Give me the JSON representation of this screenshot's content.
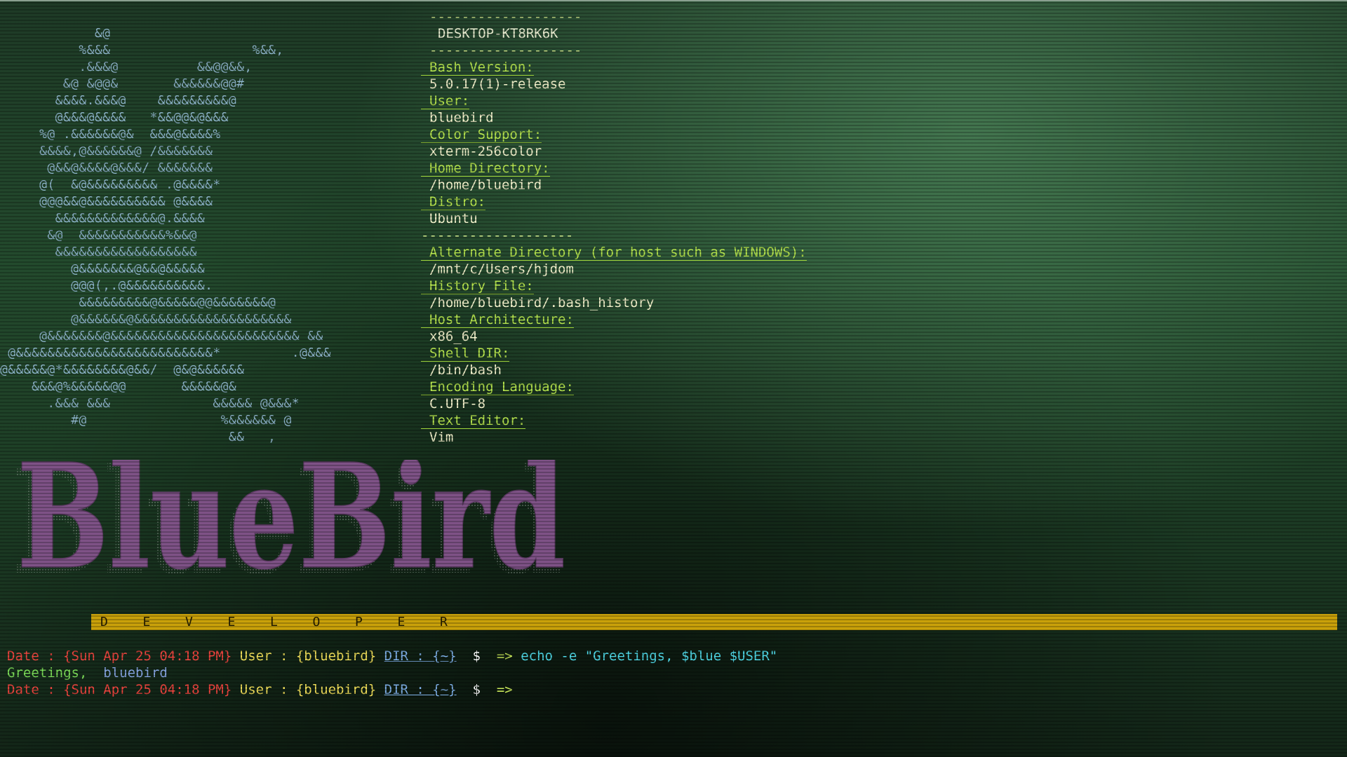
{
  "ascii_art": "            &@\n          %&&&                  %&&,\n          .&&&@          &&@@&&,\n        &@ &@@&       &&&&&&@@#\n       &&&&.&&&@    &&&&&&&&&@\n       @&&&@&&&&   *&&@@&@&&&\n     %@ .&&&&&&@&  &&&@&&&&%\n     &&&&,@&&&&&&@ /&&&&&&&\n      @&&@&&&&@&&&/ &&&&&&&\n     @(  &@&&&&&&&&& .@&&&&*\n     @@@&&@&&&&&&&&&& @&&&&\n       &&&&&&&&&&&&&@.&&&&\n      &@  &&&&&&&&&&&%&&@\n       &&&&&&&&&&&&&&&&&&\n         @&&&&&&&@&&@&&&&&\n         @@@(,.@&&&&&&&&&&.\n          &&&&&&&&&@&&&&&@@&&&&&&&@\n         @&&&&&&@&&&&&&&&&&&&&&&&&&&&\n     @&&&&&&&@&&&&&&&&&&&&&&&&&&&&&&&& &&\n @&&&&&&&&&&&&&&&&&&&&&&&&&*         .@&&&\n@&&&&&@*&&&&&&&&@&&/  @&@&&&&&&\n    &&&@%&&&&&@@       &&&&&@&\n      .&&& &&&             &&&&& @&&&*\n         #@                 %&&&&&& @\n                             &&   ,",
  "header": {
    "separator": "-------------------",
    "hostname": "DESKTOP-KT8RK6K"
  },
  "info": [
    {
      "label": "Bash Version:",
      "value": "5.0.17(1)-release"
    },
    {
      "label": "User:",
      "value": "bluebird"
    },
    {
      "label": "Color Support:",
      "value": "xterm-256color"
    },
    {
      "label": "Home Directory:",
      "value": "/home/bluebird"
    },
    {
      "label": "Distro:",
      "value": "Ubuntu"
    },
    {
      "label": "Alternate Directory (for host such as WINDOWS):",
      "value": "/mnt/c/Users/hjdom"
    },
    {
      "label": "History File:",
      "value": "/home/bluebird/.bash_history"
    },
    {
      "label": "Host Architecture:",
      "value": "x86_64"
    },
    {
      "label": "Shell DIR:",
      "value": "/bin/bash"
    },
    {
      "label": "Encoding Language:",
      "value": "C.UTF-8"
    },
    {
      "label": "Text Editor:",
      "value": "Vim"
    }
  ],
  "logo": {
    "text": "BlueBird",
    "color": "#7e5286",
    "shadow_color": "#0f1a12"
  },
  "developer_bar": {
    "letters": [
      "D",
      "E",
      "V",
      "E",
      "L",
      "O",
      "P",
      "E",
      "R"
    ],
    "color": "#c9a10a"
  },
  "prompts": [
    {
      "date": "Date : {Sun Apr 25 04:18 PM}",
      "user": "User : {bluebird}",
      "dir": "DIR : {~}",
      "dollar": "$",
      "arrow": "=>",
      "command": "echo -e \"Greetings, $blue $USER\""
    },
    {
      "date": "Date : {Sun Apr 25 04:18 PM}",
      "user": "User : {bluebird}",
      "dir": "DIR : {~}",
      "dollar": "$",
      "arrow": "=>",
      "command": ""
    }
  ],
  "output": {
    "greeting": "Greetings,",
    "name": "bluebird"
  }
}
